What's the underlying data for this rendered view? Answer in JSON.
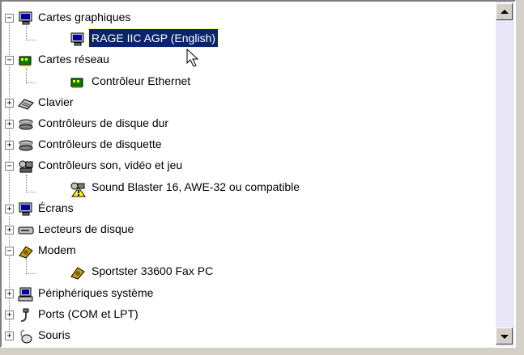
{
  "tree": {
    "items": [
      {
        "label": "Cartes graphiques",
        "expander": "−",
        "icon": "monitor-icon"
      },
      {
        "label": "RAGE IIC AGP (English)",
        "icon": "monitor-icon"
      },
      {
        "label": "Cartes réseau",
        "expander": "−",
        "icon": "network-card-icon"
      },
      {
        "label": "Contrôleur Ethernet",
        "icon": "network-card-icon"
      },
      {
        "label": "Clavier",
        "expander": "+",
        "icon": "keyboard-icon"
      },
      {
        "label": "Contrôleurs de disque dur",
        "expander": "+",
        "icon": "disk-controller-icon"
      },
      {
        "label": "Contrôleurs de disquette",
        "expander": "+",
        "icon": "disk-controller-icon"
      },
      {
        "label": "Contrôleurs son, vidéo et jeu",
        "expander": "−",
        "icon": "sound-video-game-icon"
      },
      {
        "label": "Sound Blaster 16, AWE-32 ou compatible",
        "icon": "sound-device-warning-icon"
      },
      {
        "label": "Écrans",
        "expander": "+",
        "icon": "monitor-icon"
      },
      {
        "label": "Lecteurs de disque",
        "expander": "+",
        "icon": "disk-drive-icon"
      },
      {
        "label": "Modem",
        "expander": "−",
        "icon": "modem-icon"
      },
      {
        "label": "Sportster 33600 Fax PC",
        "icon": "modem-icon"
      },
      {
        "label": "Périphériques système",
        "expander": "+",
        "icon": "computer-icon"
      },
      {
        "label": "Ports (COM et LPT)",
        "expander": "+",
        "icon": "port-icon"
      },
      {
        "label": "Souris",
        "expander": "+",
        "icon": "mouse-icon"
      }
    ]
  },
  "colors": {
    "selection": "#0a246a",
    "scroll_track": "#e8e6f8"
  }
}
